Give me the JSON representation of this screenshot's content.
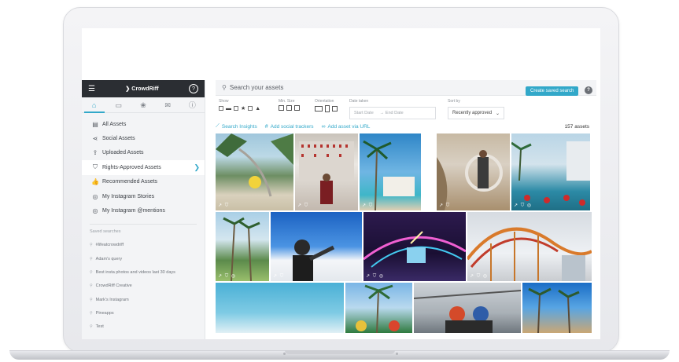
{
  "sidebar": {
    "logo": "CrowdRiff",
    "logo_mark": "❯",
    "menu_icon": "hamburger-icon",
    "help_icon": "?",
    "tabs": [
      {
        "name": "home-icon",
        "glyph": "⌂"
      },
      {
        "name": "gallery-icon",
        "glyph": "▭"
      },
      {
        "name": "social-icon",
        "glyph": "❀"
      },
      {
        "name": "megaphone-icon",
        "glyph": "✉"
      },
      {
        "name": "info-icon",
        "glyph": "ⓘ"
      }
    ],
    "items": [
      {
        "label": "All Assets",
        "icon": "▤"
      },
      {
        "label": "Social Assets",
        "icon": "⋖"
      },
      {
        "label": "Uploaded Assets",
        "icon": "⇪"
      },
      {
        "label": "Rights-Approved Assets",
        "icon": "⛉"
      },
      {
        "label": "Recommended Assets",
        "icon": "👍"
      },
      {
        "label": "My Instagram Stories",
        "icon": "◎"
      },
      {
        "label": "My Instagram @mentions",
        "icon": "◎"
      }
    ],
    "saved_title": "Saved searches",
    "saved": [
      "#lifeatcrowdriff",
      "Adam's query",
      "Best insta photos and videos last 30 days",
      "CrowdRiff Creative",
      "Mark's Instagram",
      "Pineapps",
      "Test"
    ]
  },
  "search": {
    "placeholder": "Search your assets",
    "save_button": "Create saved search",
    "help": "?"
  },
  "filters": {
    "show_label": "Show",
    "min_size_label": "Min. Size",
    "orientation_label": "Orientation",
    "date_label": "Date taken",
    "start_date": "Start Date",
    "end_date": "→ End Date",
    "sort_label": "Sort by",
    "sort_value": "Recently approved"
  },
  "actions": {
    "insights": "Search Insights",
    "trackers": "Add social trackers",
    "url": "Add asset via URL",
    "count": "157 assets"
  },
  "colors": {
    "accent": "#32a8c9",
    "topbar": "#2b2e33"
  }
}
